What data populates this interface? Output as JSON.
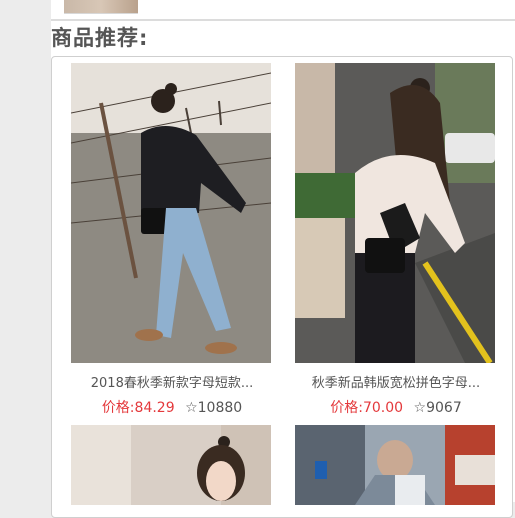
{
  "section": {
    "title": "商品推荐:"
  },
  "products": [
    {
      "name": "2018春秋季新款字母短款...",
      "price_label": "价格:",
      "price": "84.29",
      "star_icon": "star-outline-icon",
      "count": "10880"
    },
    {
      "name": "秋季新品韩版宽松拼色字母...",
      "price_label": "价格:",
      "price": "70.00",
      "star_icon": "star-outline-icon",
      "count": "9067"
    },
    {
      "name": "",
      "price_label": "",
      "price": "",
      "count": ""
    },
    {
      "name": "",
      "price_label": "",
      "price": "",
      "count": ""
    }
  ],
  "colors": {
    "price": "#e4393c",
    "text": "#555555"
  }
}
